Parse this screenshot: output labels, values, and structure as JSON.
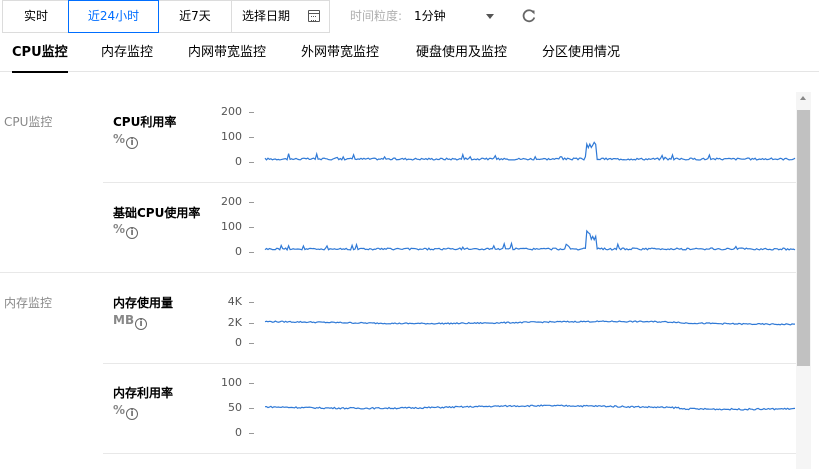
{
  "toolbar": {
    "realtime_label": "实时",
    "last24h_label": "近24小时",
    "last7d_label": "近7天",
    "date_placeholder": "选择日期",
    "granularity_label": "时间粒度:",
    "granularity_value": "1分钟"
  },
  "tabs": [
    {
      "label": "CPU监控",
      "active": true
    },
    {
      "label": "内存监控",
      "active": false
    },
    {
      "label": "内网带宽监控",
      "active": false
    },
    {
      "label": "外网带宽监控",
      "active": false
    },
    {
      "label": "硬盘使用及监控",
      "active": false
    },
    {
      "label": "分区使用情况",
      "active": false
    }
  ],
  "groups": [
    {
      "label": "CPU监控"
    },
    {
      "label": "内存监控"
    }
  ],
  "metrics": [
    {
      "title": "CPU利用率",
      "unit": "%",
      "ticks": [
        "200",
        "100",
        "0"
      ],
      "ymax": 200,
      "baseline": 12,
      "noise": 4,
      "spike_rate": 0.05,
      "spike_height": 22,
      "burst": {
        "from": 0.605,
        "to": 0.625,
        "value": 80
      }
    },
    {
      "title": "基础CPU使用率",
      "unit": "%",
      "ticks": [
        "200",
        "100",
        "0"
      ],
      "ymax": 200,
      "baseline": 12,
      "noise": 4,
      "spike_rate": 0.05,
      "spike_height": 22,
      "burst": {
        "from": 0.605,
        "to": 0.625,
        "value": 80
      }
    },
    {
      "title": "内存使用量",
      "unit": "MB",
      "ticks": [
        "4K",
        "2K",
        "0"
      ],
      "ymax": 4000,
      "baseline": 2000,
      "noise": 60,
      "drift": 200,
      "spike_rate": 0,
      "spike_height": 0
    },
    {
      "title": "内存利用率",
      "unit": "%",
      "ticks": [
        "100",
        "50",
        "0"
      ],
      "ymax": 100,
      "baseline": 52,
      "noise": 1.5,
      "drift": 5,
      "spike_rate": 0,
      "spike_height": 0
    }
  ],
  "colors": {
    "accent": "#006eff",
    "series": "#2f79d6"
  }
}
